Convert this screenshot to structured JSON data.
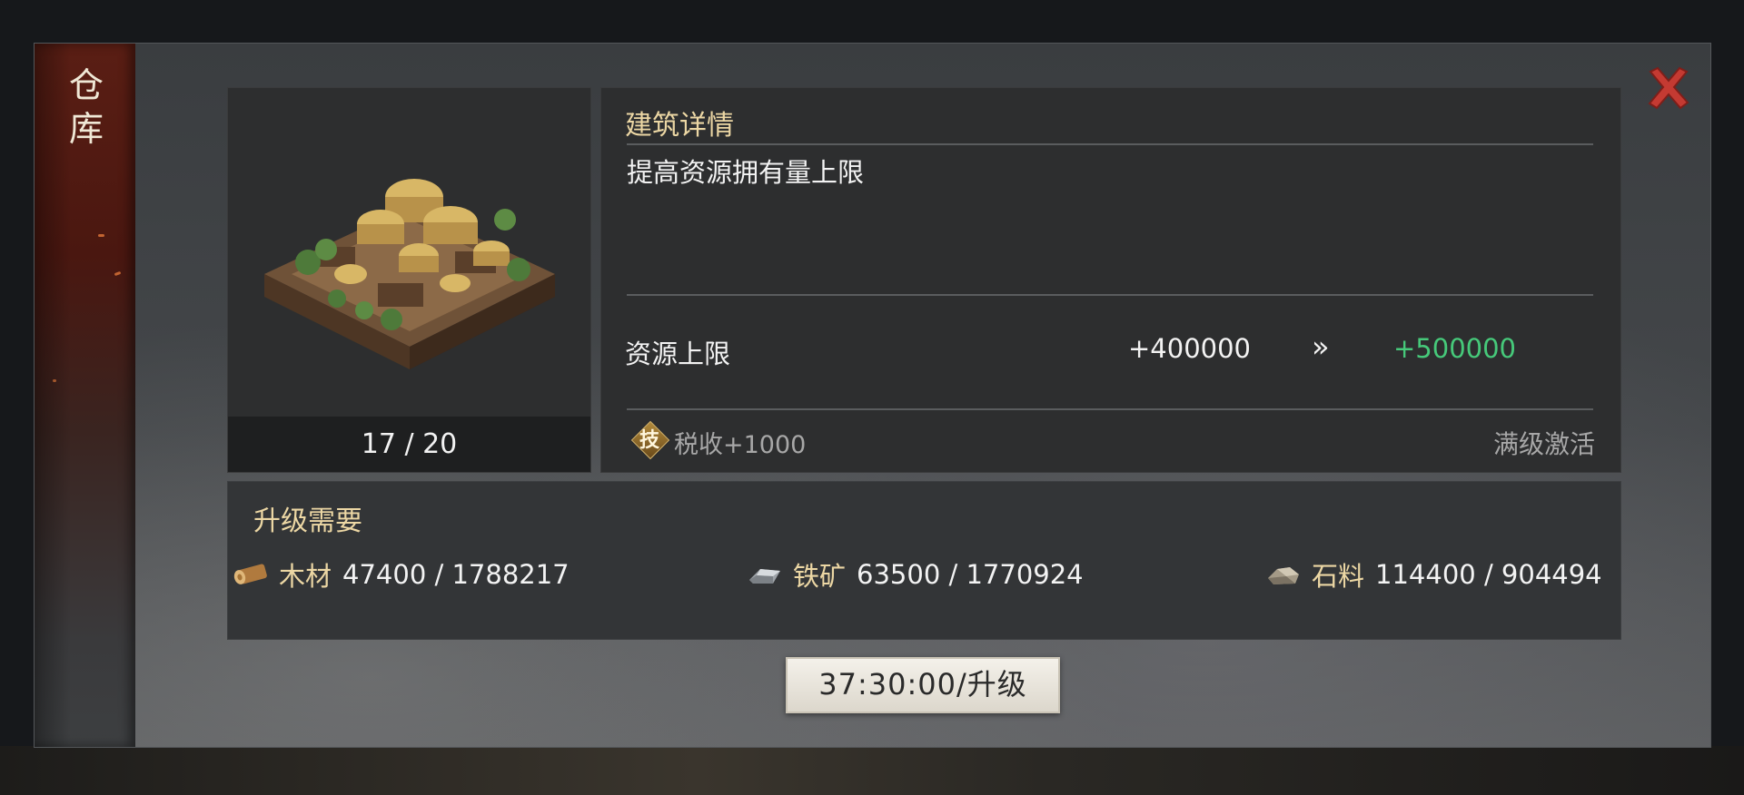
{
  "banner": {
    "title_chars": [
      "仓",
      "库"
    ]
  },
  "close": {
    "icon": "close-x-icon",
    "color": "#c43a32"
  },
  "building": {
    "image": "warehouse-building-icon",
    "level_text": "17 / 20"
  },
  "details": {
    "title": "建筑详情",
    "description": "提高资源拥有量上限",
    "stat": {
      "label": "资源上限",
      "current": "+400000",
      "arrow": "»",
      "next": "+500000",
      "next_color": "#46c97a"
    },
    "tech": {
      "badge_glyph": "技",
      "text": "税收+1000",
      "status": "满级激活"
    }
  },
  "requirements": {
    "title": "升级需要",
    "items": [
      {
        "icon": "wood-log-icon",
        "name": "木材",
        "value": "47400 / 1788217"
      },
      {
        "icon": "iron-ore-icon",
        "name": "铁矿",
        "value": "63500 / 1770924"
      },
      {
        "icon": "stone-icon",
        "name": "石料",
        "value": "114400 / 904494"
      }
    ]
  },
  "upgrade_button": {
    "label": "37:30:00/升级"
  }
}
